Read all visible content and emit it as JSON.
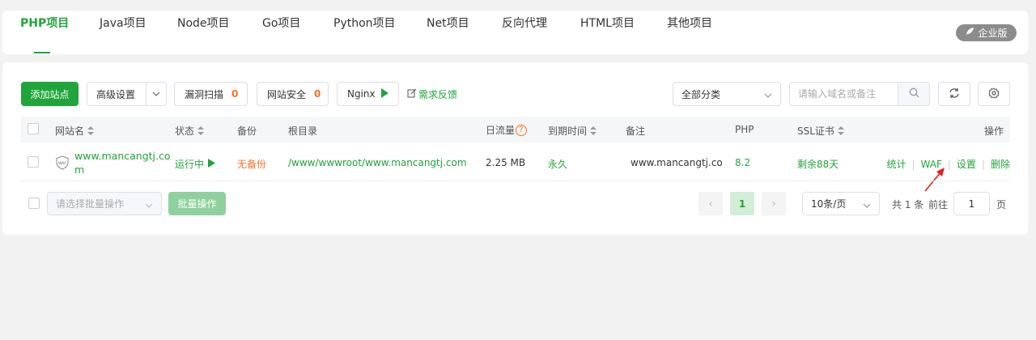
{
  "tabs": [
    {
      "label": "PHP项目"
    },
    {
      "label": "Java项目"
    },
    {
      "label": "Node项目"
    },
    {
      "label": "Go项目"
    },
    {
      "label": "Python项目"
    },
    {
      "label": "Net项目"
    },
    {
      "label": "反向代理"
    },
    {
      "label": "HTML项目"
    },
    {
      "label": "其他项目"
    }
  ],
  "enterprise_badge": "企业版",
  "toolbar": {
    "add_site": "添加站点",
    "advanced": "高级设置",
    "vuln_scan": "漏洞扫描",
    "vuln_count": "0",
    "site_security": "网站安全",
    "security_count": "0",
    "nginx": "Nginx",
    "feedback": "需求反馈",
    "category": "全部分类",
    "search_placeholder": "请输入域名或备注"
  },
  "columns": {
    "site_name": "网站名",
    "status": "状态",
    "backup": "备份",
    "root": "根目录",
    "traffic": "日流量",
    "expire": "到期时间",
    "note": "备注",
    "php": "PHP",
    "ssl": "SSL证书",
    "actions": "操作"
  },
  "rows": [
    {
      "site_name_line1": "www.mancangtj.co",
      "site_name_line2": "m",
      "waf_label": "WAF",
      "status": "运行中",
      "backup": "无备份",
      "root": "/www/wwwroot/www.mancangtj.com",
      "traffic": "2.25 MB",
      "expire": "永久",
      "note": "www.mancangtj.com",
      "php": "8.2",
      "ssl": "剩余88天",
      "actions": [
        "统计",
        "WAF",
        "设置",
        "删除"
      ]
    }
  ],
  "footer": {
    "batch_placeholder": "请选择批量操作",
    "batch_button": "批量操作",
    "current_page": "1",
    "page_size": "10条/页",
    "total": "共 1 条",
    "goto": "前往",
    "goto_value": "1",
    "page_unit": "页"
  },
  "colors": {
    "accent": "#20a53a",
    "warning": "#fc6d26",
    "annotation_arrow": "#e02020"
  }
}
